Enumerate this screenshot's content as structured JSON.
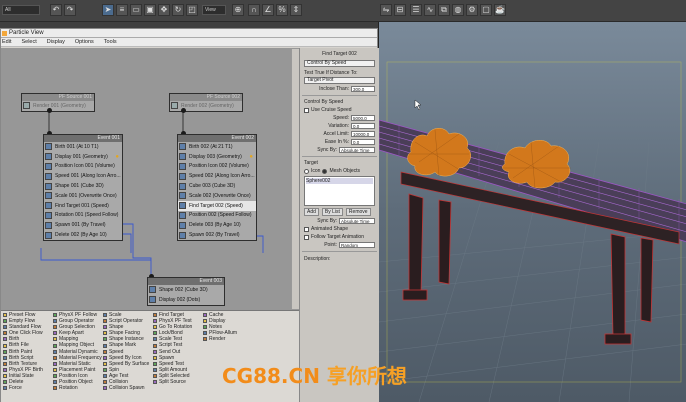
{
  "toolbar": {
    "filter_select": "All",
    "view_select": "View",
    "buttons": [
      "undo",
      "redo",
      "select-link",
      "unlink",
      "bind",
      "select",
      "select-by-name",
      "rect-region",
      "window-crossing",
      "move",
      "rotate",
      "scale",
      "snap",
      "angle-snap",
      "percent-snap",
      "spinner-snap",
      "mirror",
      "align",
      "layer",
      "curve-editor",
      "schematic",
      "material-editor",
      "render-setup",
      "render-frame",
      "render"
    ]
  },
  "window": {
    "title": "Particle View",
    "menu": [
      "Edit",
      "Select",
      "Display",
      "Options",
      "Tools"
    ]
  },
  "nodes": {
    "pf_source_001": {
      "header": "PF Source 001",
      "rows": [
        "Render 001 (Geometry)"
      ]
    },
    "pf_source_002": {
      "header": "PF Source 002",
      "rows": [
        "Render 002 (Geometry)"
      ]
    },
    "event_001": {
      "header": "Event 001",
      "rows": [
        "Birth 001 (At 10 T1)",
        "Display 001 (Geometry)",
        "Position Icon 001 (Volume)",
        "Speed 001 (Along Icon Arro...",
        "Shape 001 (Cube 3D)",
        "Scale 001 (Overwrite Once)",
        "Find Target 001 (Speed)",
        "Rotation 001 (Speed Follow)",
        "Spawn 001 (By Travel)",
        "Delete 002 (By Age 10)"
      ]
    },
    "event_002": {
      "header": "Event 002",
      "rows": [
        "Birth 002 (At 21 T1)",
        "Display 003 (Geometry)",
        "Position Icon 002 (Volume)",
        "Speed 002 (Along Icon Arro...",
        "Cube 003 (Cube 3D)",
        "Scale 002 (Overwrite Once)",
        "Find Target 002 (Speed)",
        "Position 002 (Speed Follow)",
        "Delete 003 (By Age 10)",
        "Spawn 002 (By Travel)"
      ]
    },
    "event_003": {
      "header": "Event 003",
      "rows": [
        "Shape 002 (Cube 3D)",
        "Display 002 (Dots)"
      ]
    }
  },
  "depot": {
    "columns": [
      [
        "Preset Flow",
        "Empty Flow",
        "Standard Flow",
        "One Click Flow",
        "Birth",
        "Birth File",
        "Birth Paint",
        "Birth Script",
        "Birth Texture",
        "PhysX PF Birth",
        "Initial State",
        "Delete",
        "Force"
      ],
      [
        "PhysX PF Follow",
        "Group Operator",
        "Group Selection",
        "Keep Apart",
        "Mapping",
        "Mapping Object",
        "Material Dynamic",
        "Material Frequency",
        "Material Static",
        "Placement Paint",
        "Position Icon",
        "Position Object",
        "Rotation"
      ],
      [
        "Scale",
        "Script Operator",
        "Shape",
        "Shape Facing",
        "Shape Instance",
        "Shape Mark",
        "Speed",
        "Speed By Icon",
        "Speed By Surface",
        "Spin",
        "Age Test",
        "Collision",
        "Collision Spawn"
      ],
      [
        "Find Target",
        "PhysX PF Test",
        "Go To Rotation",
        "Lock/Bond",
        "Scale Test",
        "Script Test",
        "Send Out",
        "Spawn",
        "Speed Test",
        "Split Amount",
        "Split Selected",
        "Split Source"
      ],
      [
        "Cache",
        "Display",
        "Notes",
        "PFlow-Allum",
        "Render"
      ]
    ]
  },
  "params": {
    "title": "Find Target 002",
    "control_by": "Control By Speed",
    "test_true_label": "Test True If Distance To:",
    "test_true_value": "Target Pivot",
    "inclose_label": "Inclose Than:",
    "inclose_value": "300.0",
    "control_by_speed_label": "Control By Speed",
    "use_cruise": "Use Cruise Speed",
    "speed_label": "Speed:",
    "speed_value": "5000.0",
    "variation_label": "Variation:",
    "variation_value": "0.0",
    "accel_label": "Accel Limit:",
    "accel_value": "10000.0",
    "ease_label": "Ease In %:",
    "ease_value": "0.0",
    "sync_label": "Sync By:",
    "sync_value": "Absolute Time",
    "target_label": "Target",
    "icon_radio": "Icon",
    "mesh_radio": "Mesh Objects",
    "target_list": [
      "Sphere002"
    ],
    "add": "Add",
    "by_list": "By List",
    "remove": "Remove",
    "sync2_label": "Sync By:",
    "sync2_value": "Absolute Time",
    "animated_shape": "Animated Shape",
    "follow_target": "Follow Target Animation",
    "point_label": "Point:",
    "point_value": "Random",
    "description_label": "Description:"
  },
  "watermark": {
    "latin": "CG88.CN",
    "cjk": "享你所想"
  }
}
